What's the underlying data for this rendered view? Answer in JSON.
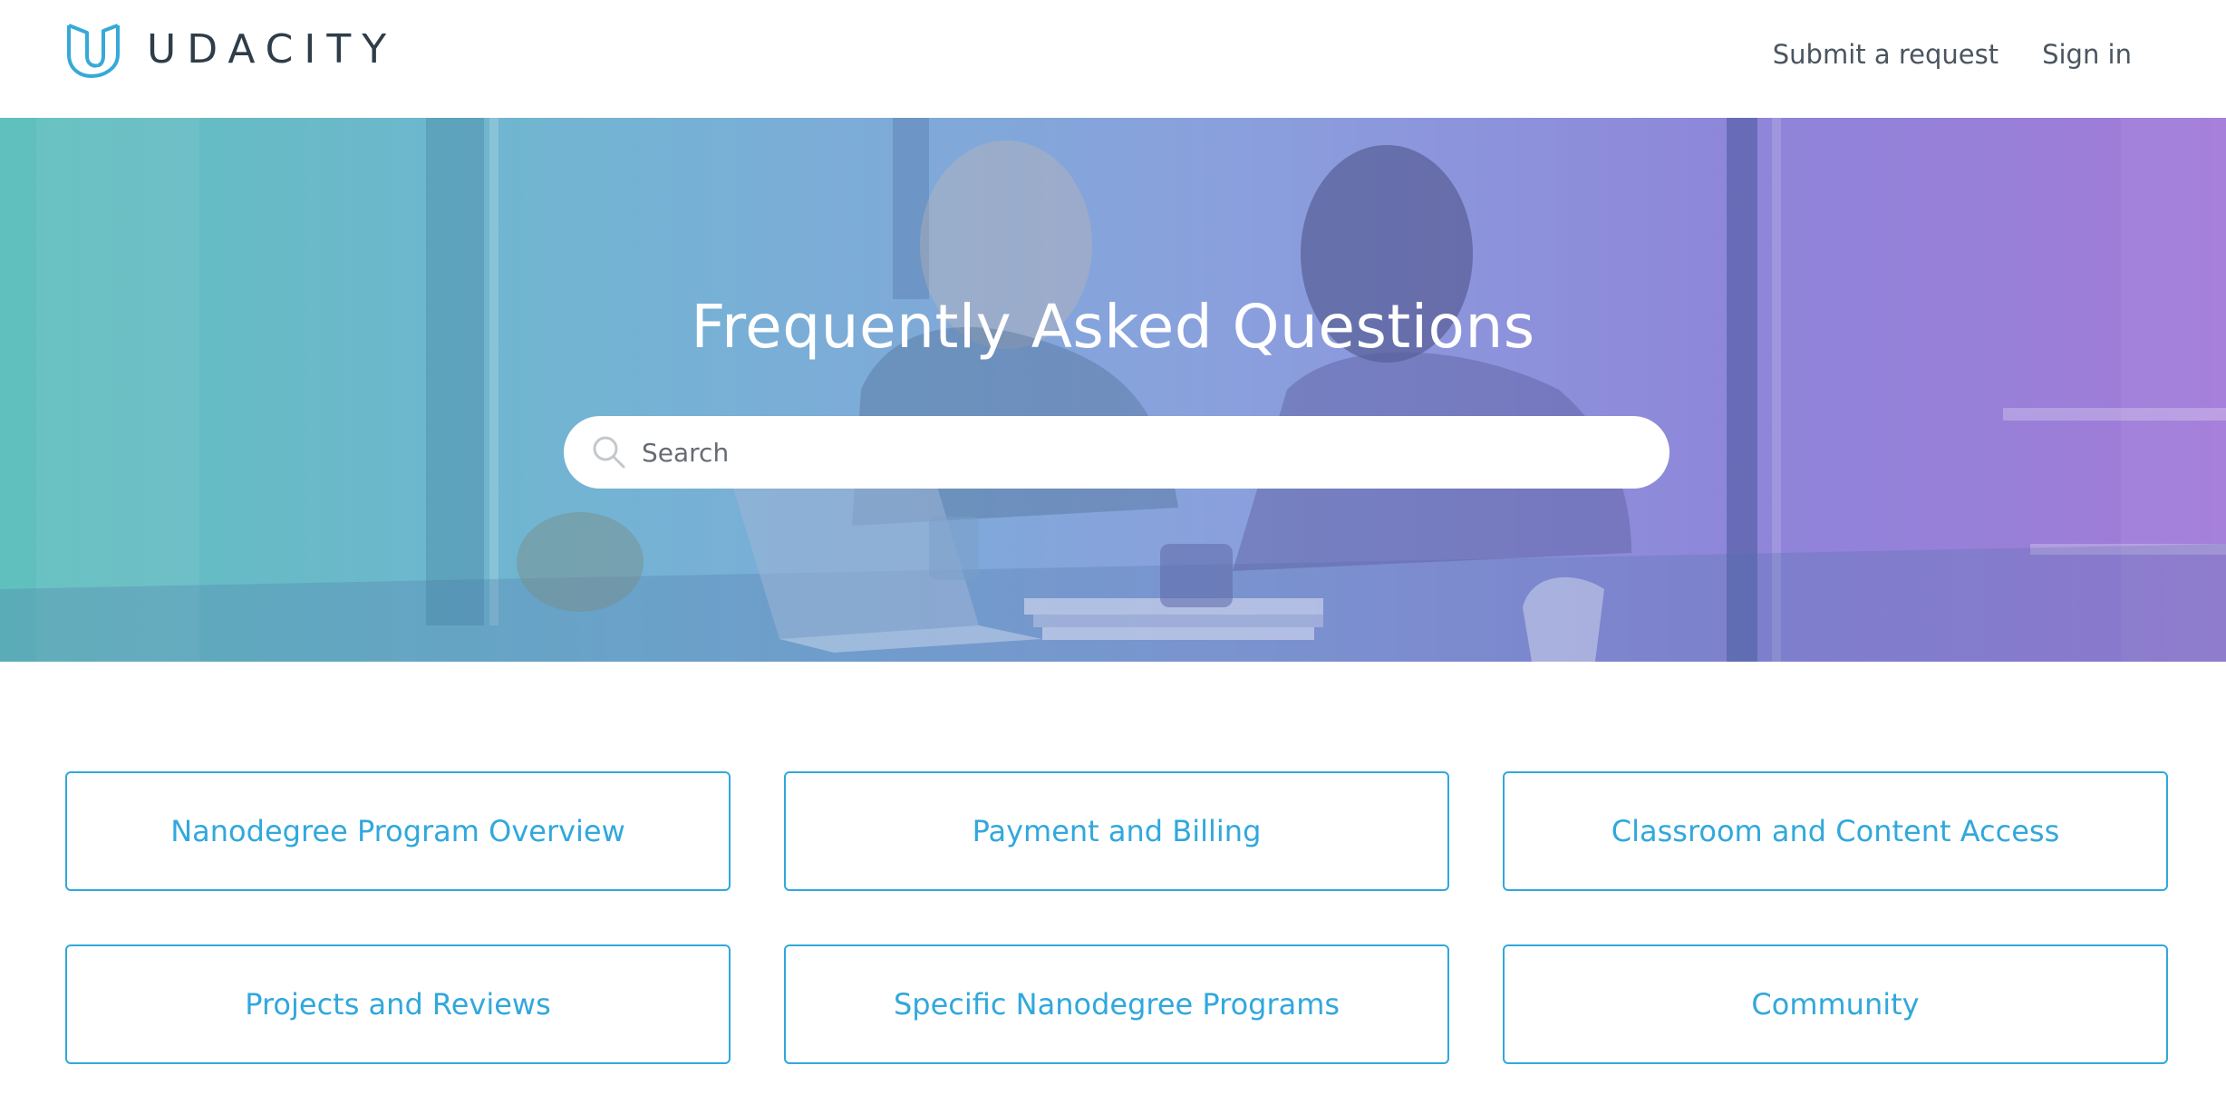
{
  "header": {
    "logo_text": "UDACITY",
    "brand_color": "#02b3e4",
    "nav": [
      {
        "label": "Submit a request"
      },
      {
        "label": "Sign in"
      }
    ]
  },
  "hero": {
    "title": "Frequently Asked Questions",
    "search": {
      "placeholder": "Search",
      "value": ""
    },
    "gradient_colors": [
      "#5fc0bd",
      "#8aa0dd",
      "#a27ad8"
    ]
  },
  "categories": [
    {
      "label": "Nanodegree Program Overview"
    },
    {
      "label": "Payment and Billing"
    },
    {
      "label": "Classroom and Content Access"
    },
    {
      "label": "Projects and Reviews"
    },
    {
      "label": "Specific Nanodegree Programs"
    },
    {
      "label": "Community"
    }
  ],
  "colors": {
    "accent": "#31a8dc",
    "nav_text": "#4a5560",
    "logo_text": "#2e3d49"
  },
  "icons": [
    "udacity-logo-icon",
    "search-icon"
  ]
}
